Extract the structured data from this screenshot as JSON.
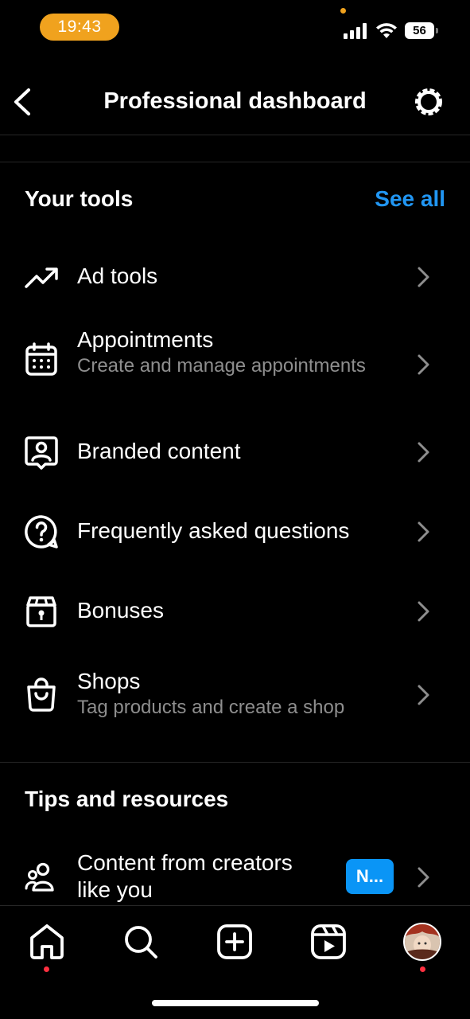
{
  "status_bar": {
    "time": "19:43",
    "battery": "56"
  },
  "header": {
    "title": "Professional dashboard"
  },
  "your_tools": {
    "title": "Your tools",
    "see_all": "See all",
    "items": [
      {
        "label": "Ad tools",
        "subtitle": "",
        "icon": "trending-up-icon"
      },
      {
        "label": "Appointments",
        "subtitle": "Create and manage appointments",
        "icon": "calendar-icon"
      },
      {
        "label": "Branded content",
        "subtitle": "",
        "icon": "branded-content-icon"
      },
      {
        "label": "Frequently asked questions",
        "subtitle": "",
        "icon": "question-bubble-icon"
      },
      {
        "label": "Bonuses",
        "subtitle": "",
        "icon": "bonus-box-icon"
      },
      {
        "label": "Shops",
        "subtitle": "Tag products and create a shop",
        "icon": "shopping-bag-icon"
      }
    ]
  },
  "tips": {
    "title": "Tips and resources",
    "items": [
      {
        "label": "Content from creators like you",
        "badge": "N...",
        "icon": "people-icon"
      }
    ]
  },
  "tab_bar": {
    "tabs": [
      "home-icon",
      "search-icon",
      "create-icon",
      "reels-icon",
      "profile-avatar"
    ]
  },
  "colors": {
    "accent": "#2196f3",
    "badge": "#0a95f6",
    "time_pill": "#f0a21e",
    "notification_dot": "#ff3040"
  }
}
